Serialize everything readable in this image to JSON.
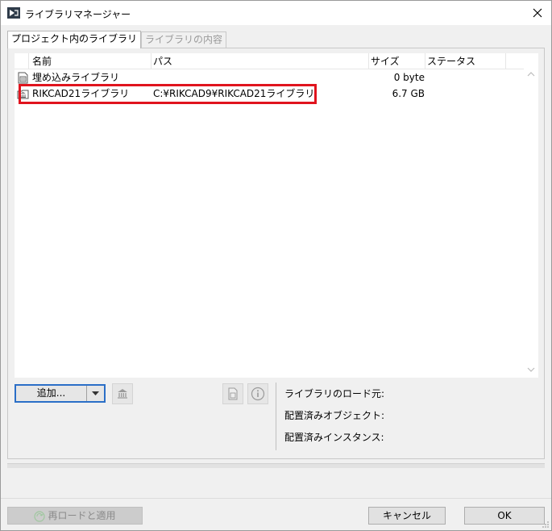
{
  "window": {
    "title": "ライブラリマネージャー"
  },
  "tabs": [
    {
      "label": "プロジェクト内のライブラリ",
      "active": true
    },
    {
      "label": "ライブラリの内容",
      "active": false
    }
  ],
  "list": {
    "columns": [
      "名前",
      "パス",
      "サイズ",
      "ステータス"
    ],
    "rows": [
      {
        "name": "埋め込みライブラリ",
        "path": "",
        "size": "0 byte",
        "status": "",
        "icon": "embedded-library-icon"
      },
      {
        "name": "RIKCAD21ライブラリ",
        "path": "C:¥RIKCAD9¥RIKCAD21ライブラリ",
        "size": "6.7 GB",
        "status": "",
        "icon": "library-folder-icon"
      }
    ]
  },
  "controls": {
    "add_label": "追加...",
    "info_labels": {
      "load_source": "ライブラリのロード元:",
      "placed_objects": "配置済みオブジェクト:",
      "placed_instances": "配置済みインスタンス:"
    }
  },
  "footer": {
    "reload_label": "再ロードと適用",
    "cancel_label": "キャンセル",
    "ok_label": "OK"
  },
  "colors": {
    "highlight": "#e0141e",
    "focus": "#2b6fc7"
  }
}
